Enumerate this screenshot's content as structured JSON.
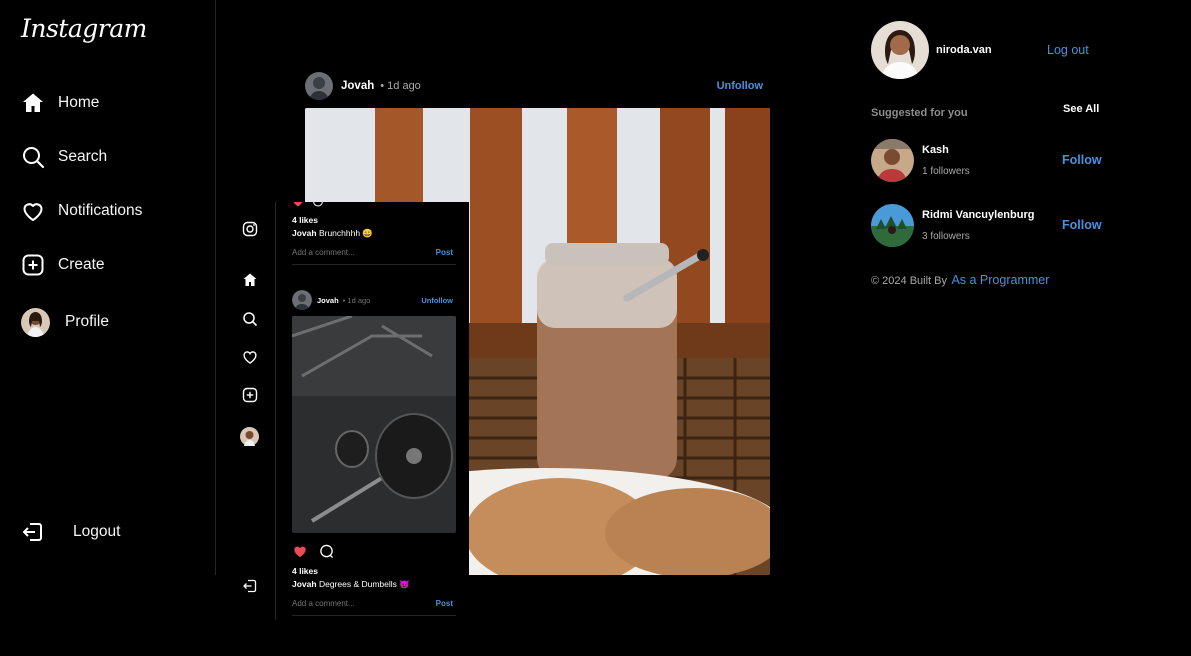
{
  "app": {
    "logo": "Instagram"
  },
  "sidebar": {
    "items": [
      {
        "label": "Home",
        "icon": "home-icon"
      },
      {
        "label": "Search",
        "icon": "search-icon"
      },
      {
        "label": "Notifications",
        "icon": "heart-icon"
      },
      {
        "label": "Create",
        "icon": "plus-square-icon"
      },
      {
        "label": "Profile",
        "icon": "avatar"
      }
    ],
    "logout": "Logout"
  },
  "feed": {
    "post": {
      "username": "Jovah",
      "time": "• 1d ago",
      "follow_label": "Unfollow"
    }
  },
  "mobile": {
    "prev_post": {
      "likes": "4 likes",
      "username": "Jovah",
      "caption": "Brunchhhh 😄",
      "comment_placeholder": "Add a comment...",
      "post_label": "Post"
    },
    "post": {
      "username": "Jovah",
      "time": "• 1d ago",
      "follow_label": "Unfollow",
      "likes": "4 likes",
      "caption": "Degrees & Dumbells 😈",
      "comment_placeholder": "Add a comment...",
      "post_label": "Post"
    }
  },
  "right": {
    "me": {
      "username": "niroda.van",
      "logout": "Log out"
    },
    "suggested_title": "Suggested for you",
    "see_all": "See All",
    "suggestions": [
      {
        "name": "Kash",
        "followers": "1 followers",
        "action": "Follow"
      },
      {
        "name": "Ridmi Vancuylenburg",
        "followers": "3 followers",
        "action": "Follow"
      }
    ],
    "footer_prefix": "© 2024 Built By",
    "footer_link": "As a Programmer"
  },
  "colors": {
    "accent": "#4a90e2",
    "like": "#ed4956",
    "background": "#000000"
  }
}
